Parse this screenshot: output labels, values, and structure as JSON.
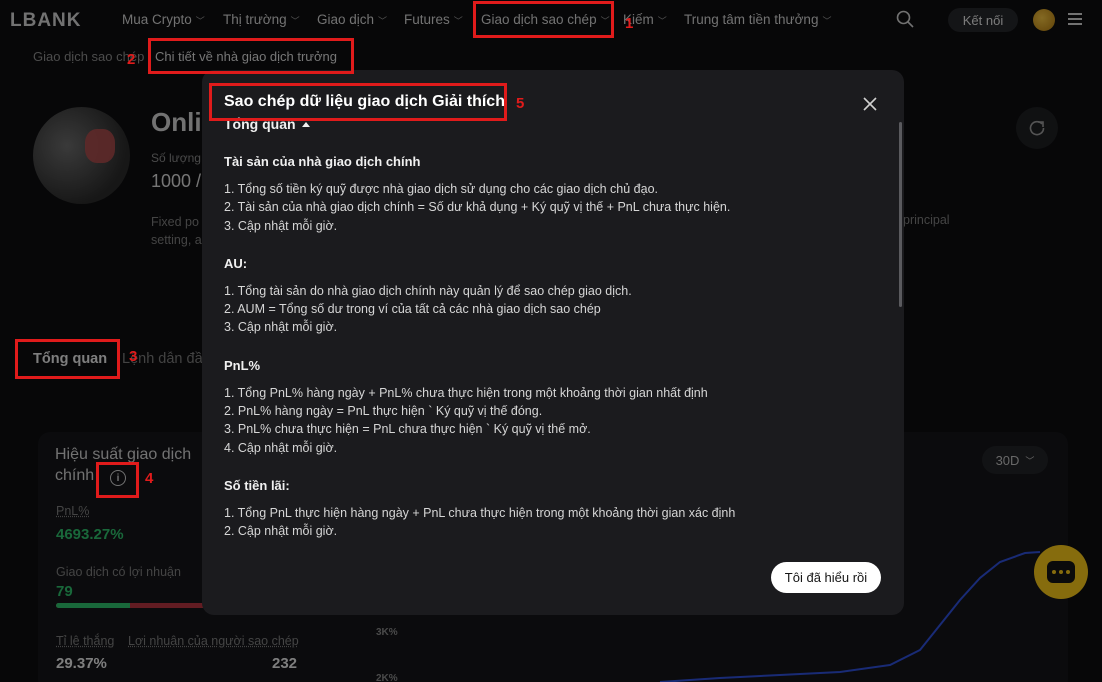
{
  "nav": {
    "logo": "LBANK",
    "items": [
      "Mua Crypto",
      "Thị trường",
      "Giao dịch",
      "Futures",
      "Giao dịch sao chép",
      "Kiếm",
      "Trung tâm tiền thưởng"
    ],
    "connect_label": "Kết nối"
  },
  "breadcrumb": {
    "root": "Giao dịch sao chép",
    "current": "Chi tiết về nhà giao dịch trưởng"
  },
  "trader": {
    "name": "Onli",
    "count_label": "Số lượng",
    "count_value": "1000 /",
    "desc_left": "Fixed po",
    "desc_left2": "setting, a",
    "desc_right": "principal"
  },
  "tabs": {
    "overview": "Tổng quan",
    "orders": "Lệnh dẫn đầu"
  },
  "performance": {
    "title": "Hiệu suất giao dịch chính",
    "period": "30D",
    "pnl_label": "PnL%",
    "pnl_value": "4693.27%",
    "profitable_label": "Giao dịch có lợi nhuận",
    "profitable_value": "79",
    "winrate_label": "Tỉ lệ thắng",
    "winrate_value": "29.37%",
    "copier_profit_label": "Lợi nhuận của người sao chép",
    "copier_profit_value": "232",
    "winrate_fraction": 0.4937,
    "axis_3k": "3K%",
    "axis_2k": "2K%"
  },
  "modal": {
    "title": "Sao chép dữ liệu giao dịch Giải thích",
    "section": "Tổng quan",
    "blocks": [
      {
        "title": "Tài sản của nhà giao dịch chính",
        "lines": [
          "1. Tổng số tiền ký quỹ được nhà giao dịch sử dụng cho các giao dịch chủ đạo.",
          "2. Tài sản của nhà giao dịch chính = Số dư khả dụng + Ký quỹ vị thế + PnL chưa thực hiện.",
          "3. Cập nhật mỗi giờ."
        ]
      },
      {
        "title": "AU:",
        "lines": [
          "1. Tổng tài sản do nhà giao dịch chính này quản lý để sao chép giao dịch.",
          "2. AUM = Tổng số dư trong ví của tất cả các nhà giao dịch sao chép",
          "3. Cập nhật mỗi giờ."
        ]
      },
      {
        "title": "PnL%",
        "lines": [
          "1. Tổng PnL% hàng ngày + PnL% chưa thực hiện trong một khoảng thời gian nhất định",
          "2. PnL% hàng ngày = PnL thực hiện ` Ký quỹ vị thế đóng.",
          "3. PnL% chưa thực hiện = PnL chưa thực hiện ` Ký quỹ vị thế mở.",
          "4. Cập nhật mỗi giờ."
        ]
      },
      {
        "title": "Số tiền lãi:",
        "lines": [
          "1. Tổng PnL thực hiện hàng ngày + PnL chưa thực hiện trong một khoảng thời gian xác định",
          "2. Cập nhật mỗi giờ."
        ]
      }
    ],
    "ok_label": "Tôi đã hiểu rồi"
  },
  "annotations": [
    "1",
    "2",
    "3",
    "4",
    "5"
  ],
  "colors": {
    "annotation": "#e01b1b",
    "profit": "#2ebd6b",
    "loss": "#b2343f",
    "chat": "#f5c518",
    "chart_line": "#2f4fd8"
  }
}
